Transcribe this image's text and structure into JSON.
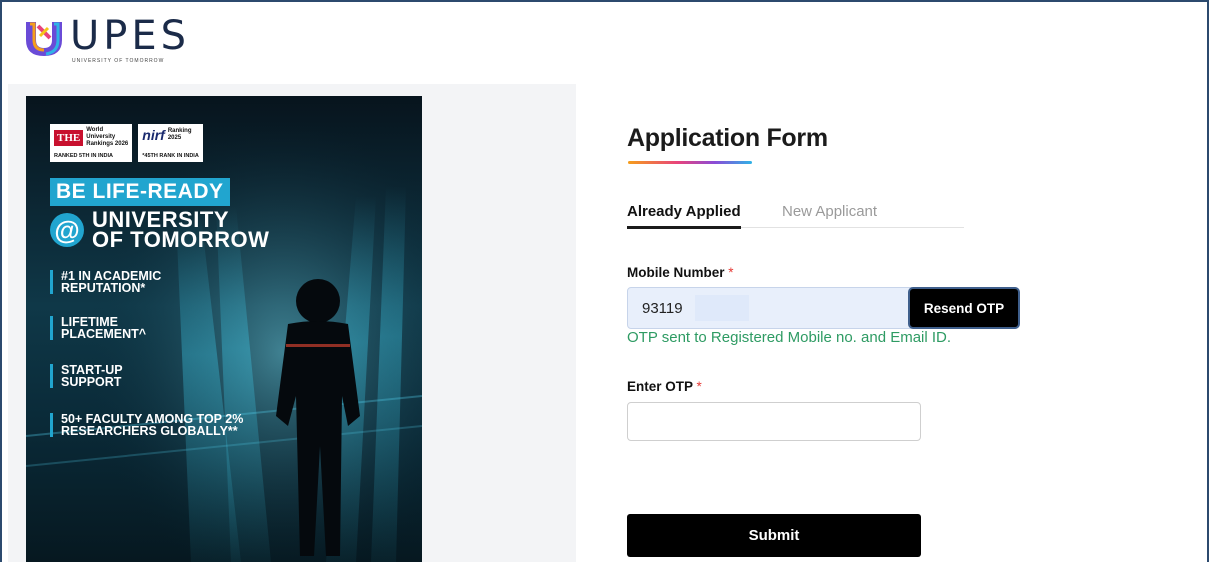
{
  "header": {
    "logo_word": "UPES",
    "logo_tagline": "UNIVERSITY OF TOMORROW"
  },
  "poster": {
    "rank_the": {
      "badge": "THE",
      "line1": "World",
      "line2": "University",
      "line3": "Rankings 2026",
      "foot": "RANKED 5TH IN INDIA"
    },
    "rank_nirf": {
      "badge": "nirf",
      "line1": "Ranking",
      "line2": "2025",
      "foot": "*45TH RANK IN INDIA"
    },
    "headline": "BE LIFE-READY",
    "at_symbol": "@",
    "university_line1": "UNIVERSITY",
    "university_line2": "OF TOMORROW",
    "features": [
      {
        "line1": "#1 IN ACADEMIC",
        "line2": "REPUTATION*"
      },
      {
        "line1": "LIFETIME",
        "line2": "PLACEMENT^"
      },
      {
        "line1": "START-UP",
        "line2": "SUPPORT"
      },
      {
        "line1": "50+ FACULTY AMONG TOP 2%",
        "line2": "RESEARCHERS GLOBALLY**"
      }
    ]
  },
  "form": {
    "title": "Application Form",
    "tabs": [
      {
        "label": "Already Applied",
        "active": true
      },
      {
        "label": "New Applicant",
        "active": false
      }
    ],
    "mobile_label": "Mobile Number",
    "required_mark": "*",
    "mobile_value": "93119",
    "resend_label": "Resend OTP",
    "otp_message": "OTP sent to Registered Mobile no. and Email ID.",
    "otp_label": "Enter OTP",
    "otp_value": "",
    "submit_label": "Submit"
  },
  "colors": {
    "accent_cyan": "#21a5cf",
    "success_green": "#2e9b63",
    "required_red": "#e53935",
    "button_black": "#000000"
  }
}
